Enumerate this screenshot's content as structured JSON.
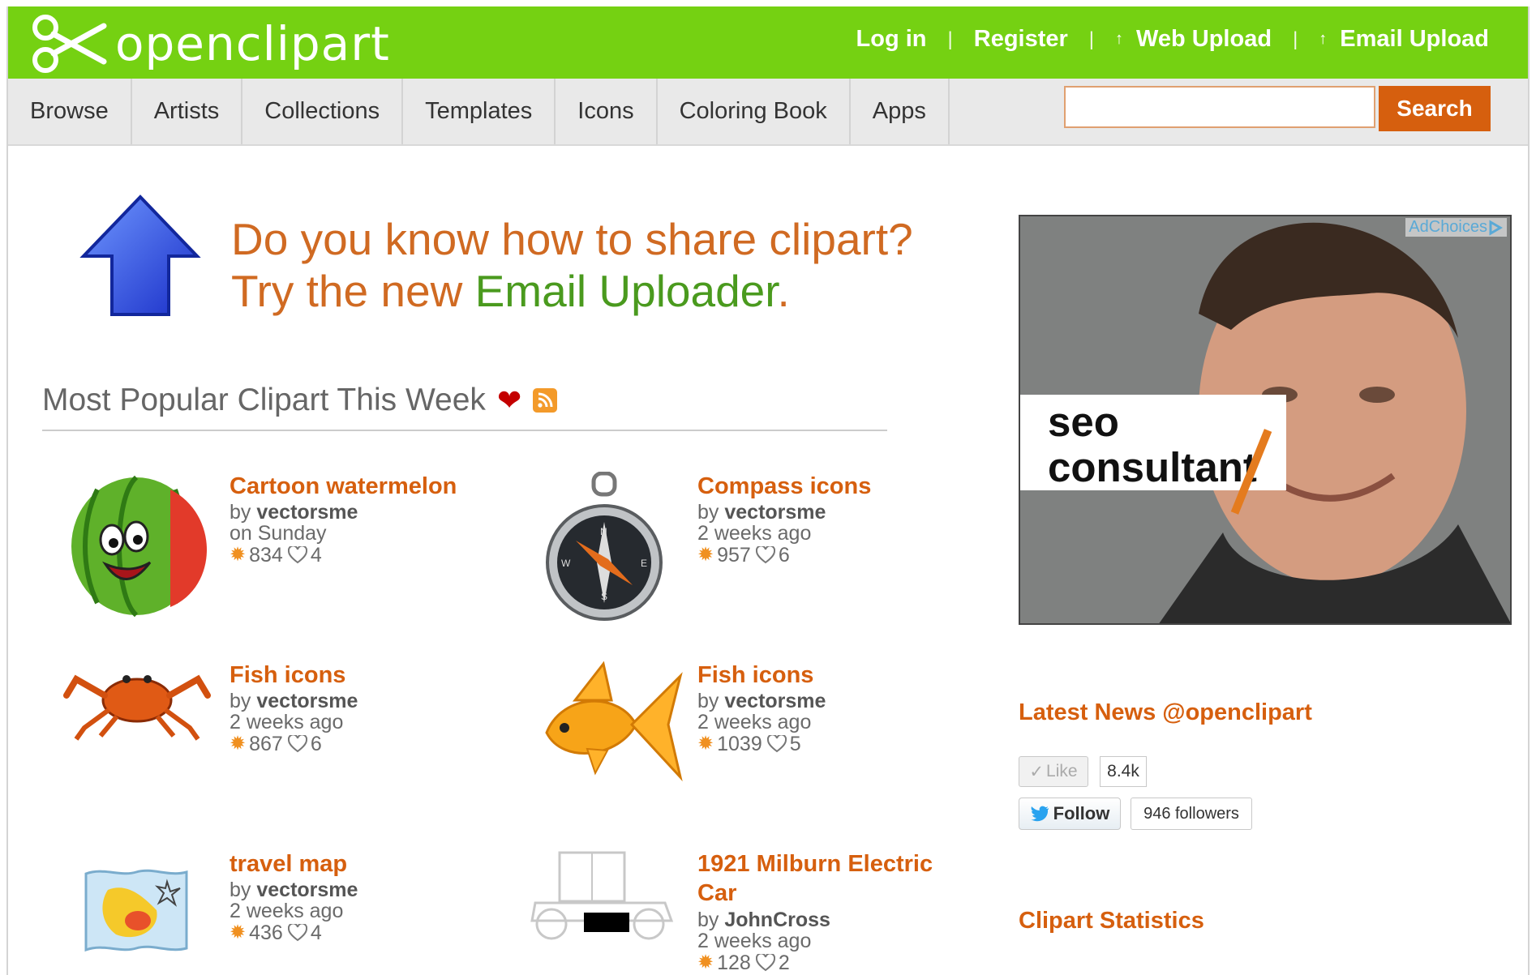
{
  "header": {
    "logo_text": "openclipart",
    "links": {
      "login": "Log in",
      "register": "Register",
      "web_upload": "Web Upload",
      "email_upload": "Email Upload",
      "separator": "|",
      "upload_arrow": "↑"
    }
  },
  "nav": {
    "items": [
      "Browse",
      "Artists",
      "Collections",
      "Templates",
      "Icons",
      "Coloring Book",
      "Apps"
    ],
    "search_placeholder": "",
    "search_button": "Search"
  },
  "promo": {
    "line1": "Do you know how to share clipart?",
    "line2_prefix": "Try the new ",
    "line2_link": "Email Uploader",
    "line2_suffix": "."
  },
  "popular": {
    "title": "Most Popular Clipart This Week",
    "items": [
      {
        "title": "Cartoon watermelon",
        "by": "by",
        "author": "vectorsme",
        "date": "on Sunday",
        "downloads": "834",
        "favorites": "4",
        "thumb_icon": "watermelon-icon"
      },
      {
        "title": "Compass icons",
        "by": "by",
        "author": "vectorsme",
        "date": "2 weeks ago",
        "downloads": "957",
        "favorites": "6",
        "thumb_icon": "compass-icon"
      },
      {
        "title": "Fish icons",
        "by": "by",
        "author": "vectorsme",
        "date": "2 weeks ago",
        "downloads": "867",
        "favorites": "6",
        "thumb_icon": "crab-icon"
      },
      {
        "title": "Fish icons",
        "by": "by",
        "author": "vectorsme",
        "date": "2 weeks ago",
        "downloads": "1039",
        "favorites": "5",
        "thumb_icon": "goldfish-icon"
      },
      {
        "title": "travel map",
        "by": "by",
        "author": "vectorsme",
        "date": "2 weeks ago",
        "downloads": "436",
        "favorites": "4",
        "thumb_icon": "map-icon"
      },
      {
        "title_line1": "1921 Milburn Electric",
        "title_line2": "Car",
        "by": "by",
        "author": "JohnCross",
        "date": "2 weeks ago",
        "downloads": "128",
        "favorites": "2",
        "thumb_icon": "car-icon"
      }
    ]
  },
  "ad": {
    "adchoices": "AdChoices",
    "line1": "seo",
    "line2": "consultant"
  },
  "sidebar": {
    "news_title": "Latest News @openclipart",
    "like_label": "Like",
    "like_count": "8.4k",
    "follow_label": "Follow",
    "followers": "946 followers",
    "stats_title": "Clipart Statistics"
  },
  "colors": {
    "header_green": "#75d112",
    "accent_orange": "#d65f0e",
    "link_green": "#4a9a1e"
  }
}
